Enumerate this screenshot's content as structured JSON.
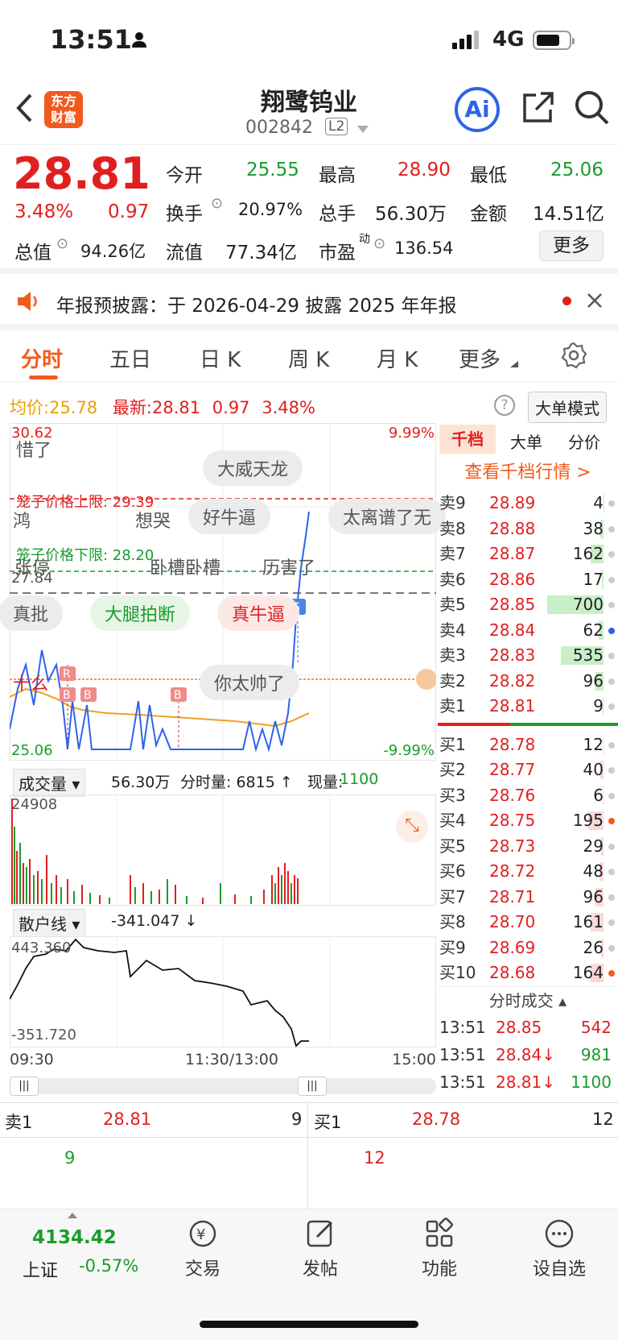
{
  "status": {
    "time": "13:51",
    "network": "4G"
  },
  "header": {
    "name": "翔鹭钨业",
    "code": "002842",
    "level": "L2",
    "logo": "东方财富",
    "ai_label": "Ai"
  },
  "quote": {
    "price": "28.81",
    "pct": "3.48%",
    "change": "0.97",
    "open_label": "今开",
    "open": "25.55",
    "high_label": "最高",
    "high": "28.90",
    "low_label": "最低",
    "low": "25.06",
    "turnover_label": "换手",
    "turnover": "20.97%",
    "volume_label": "总手",
    "volume": "56.30万",
    "amount_label": "金额",
    "amount": "14.51亿",
    "mktcap_label": "总值",
    "mktcap": "94.26亿",
    "float_label": "流值",
    "float": "77.34亿",
    "pe_label": "市盈",
    "pe_sup": "动",
    "pe": "136.54",
    "more": "更多"
  },
  "notice": {
    "text": "年报预披露：于 2026-04-29 披露 2025 年年报"
  },
  "tabs": [
    "分时",
    "五日",
    "日 K",
    "周 K",
    "月 K",
    "更多"
  ],
  "info": {
    "avg_label": "均价:",
    "avg": "25.78",
    "latest_label": "最新:",
    "latest": "28.81",
    "chg": "0.97",
    "pct": "3.48%",
    "mode": "大单模式"
  },
  "chart": {
    "top_price": "30.62",
    "top_pct": "9.99%",
    "bottom_price": "25.06",
    "bottom_pct": "-9.99%",
    "upper_limit": "笼子价格上限: 29.39",
    "lower_limit": "笼子价格下限: 28.20",
    "prev_close": "27.84",
    "vol_label": "成交量",
    "vol_total": "56.30万",
    "tick_vol": "分时量: 6815 ↑",
    "cur_vol_label": "现量:",
    "cur_vol": "1100",
    "vol_max": "24908",
    "retail_label": "散户线",
    "retail_value": "-341.047 ↓",
    "retail_top": "443.360",
    "retail_bottom": "-351.720",
    "times": [
      "09:30",
      "11:30/13:00",
      "15:00"
    ],
    "danmaku": [
      "惜了",
      "大威天龙",
      "鸿",
      "想哭",
      "好牛逼",
      "太离谱了无",
      "张停",
      "卧槽卧槽",
      "历害了",
      "真批",
      "大腿拍断",
      "真牛逼",
      "十么",
      "你太帅了"
    ]
  },
  "orderbook": {
    "tabs": [
      "千档",
      "大单",
      "分价"
    ],
    "link": "查看千档行情 >",
    "asks": [
      [
        "卖9",
        "28.89",
        "4"
      ],
      [
        "卖8",
        "28.88",
        "38"
      ],
      [
        "卖7",
        "28.87",
        "162"
      ],
      [
        "卖6",
        "28.86",
        "17"
      ],
      [
        "卖5",
        "28.85",
        "700"
      ],
      [
        "卖4",
        "28.84",
        "62"
      ],
      [
        "卖3",
        "28.83",
        "535"
      ],
      [
        "卖2",
        "28.82",
        "96"
      ],
      [
        "卖1",
        "28.81",
        "9"
      ]
    ],
    "bids": [
      [
        "买1",
        "28.78",
        "12"
      ],
      [
        "买2",
        "28.77",
        "40"
      ],
      [
        "买3",
        "28.76",
        "6"
      ],
      [
        "买4",
        "28.75",
        "195"
      ],
      [
        "买5",
        "28.73",
        "29"
      ],
      [
        "买6",
        "28.72",
        "48"
      ],
      [
        "买7",
        "28.71",
        "96"
      ],
      [
        "买8",
        "28.70",
        "161"
      ],
      [
        "买9",
        "28.69",
        "26"
      ],
      [
        "买10",
        "28.68",
        "164"
      ]
    ],
    "ticks_label": "分时成交",
    "ticks": [
      [
        "13:51",
        "28.85",
        "542"
      ],
      [
        "13:51",
        "28.84↓",
        "981"
      ],
      [
        "13:51",
        "28.81↓",
        "1100"
      ]
    ]
  },
  "level1": {
    "ask_label": "卖1",
    "ask_price": "28.81",
    "ask_vol": "9",
    "ask_q": "9",
    "bid_label": "买1",
    "bid_price": "28.78",
    "bid_vol": "12",
    "bid_q": "12"
  },
  "nav": {
    "index_value": "4134.42",
    "index_name": "上证",
    "index_pct": "-0.57%",
    "items": [
      "交易",
      "发帖",
      "功能",
      "设自选"
    ]
  },
  "colors": {
    "red": "#e02020",
    "green": "#1a9c2b",
    "orange": "#f25a1d",
    "blue": "#2d63e8"
  }
}
